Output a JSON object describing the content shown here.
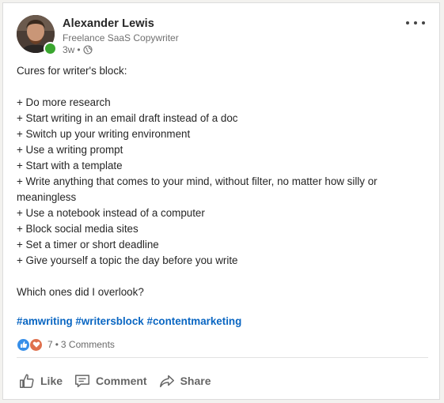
{
  "author": {
    "name": "Alexander Lewis",
    "headline": "Freelance SaaS Copywriter",
    "time": "3w",
    "separator": "•",
    "visibility_icon": "globe-icon",
    "presence": "online",
    "presence_color": "#3aa62f"
  },
  "post": {
    "intro": "Cures for writer's block:",
    "items": [
      "+ Do more research",
      "+ Start writing in an email draft instead of a doc",
      "+ Switch up your writing environment",
      "+ Use a writing prompt",
      "+ Start with a template",
      "+ Write anything that comes to your mind, without filter, no matter how silly or",
      "meaningless",
      "+ Use a notebook instead of a computer",
      "+ Block social media sites",
      "+ Set a timer or short deadline",
      "+ Give yourself a topic the day before you write"
    ],
    "question": "Which ones did I overlook?",
    "hashtags": [
      "#amwriting",
      "#writersblock",
      "#contentmarketing"
    ]
  },
  "social": {
    "reactions": [
      "like-reaction-icon",
      "love-reaction-icon"
    ],
    "reaction_count": "7",
    "dot": "•",
    "comments": "3 Comments"
  },
  "actions": {
    "like": "Like",
    "comment": "Comment",
    "share": "Share"
  },
  "colors": {
    "link": "#0a66c2",
    "like_blue": "#378fe9",
    "love_orange": "#df704d"
  }
}
